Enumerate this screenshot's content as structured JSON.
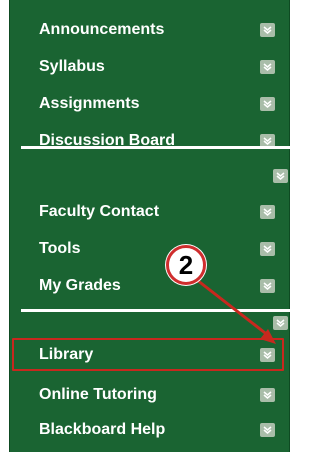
{
  "menu": {
    "items": [
      {
        "label": "Announcements"
      },
      {
        "label": "Syllabus"
      },
      {
        "label": "Assignments"
      },
      {
        "label": "Discussion Board"
      },
      {
        "label": "Faculty Contact"
      },
      {
        "label": "Tools"
      },
      {
        "label": "My Grades"
      },
      {
        "label": "Library"
      },
      {
        "label": "Online Tutoring"
      },
      {
        "label": "Blackboard Help"
      }
    ],
    "highlighted_item": "Library"
  },
  "callout": {
    "number": "2"
  },
  "colors": {
    "panel": "#1a6432",
    "text": "#ffffff",
    "chevron_bg": "#a9bda9",
    "highlight": "#c8281e"
  },
  "icons": {
    "expand": "chevron-down-icon"
  }
}
